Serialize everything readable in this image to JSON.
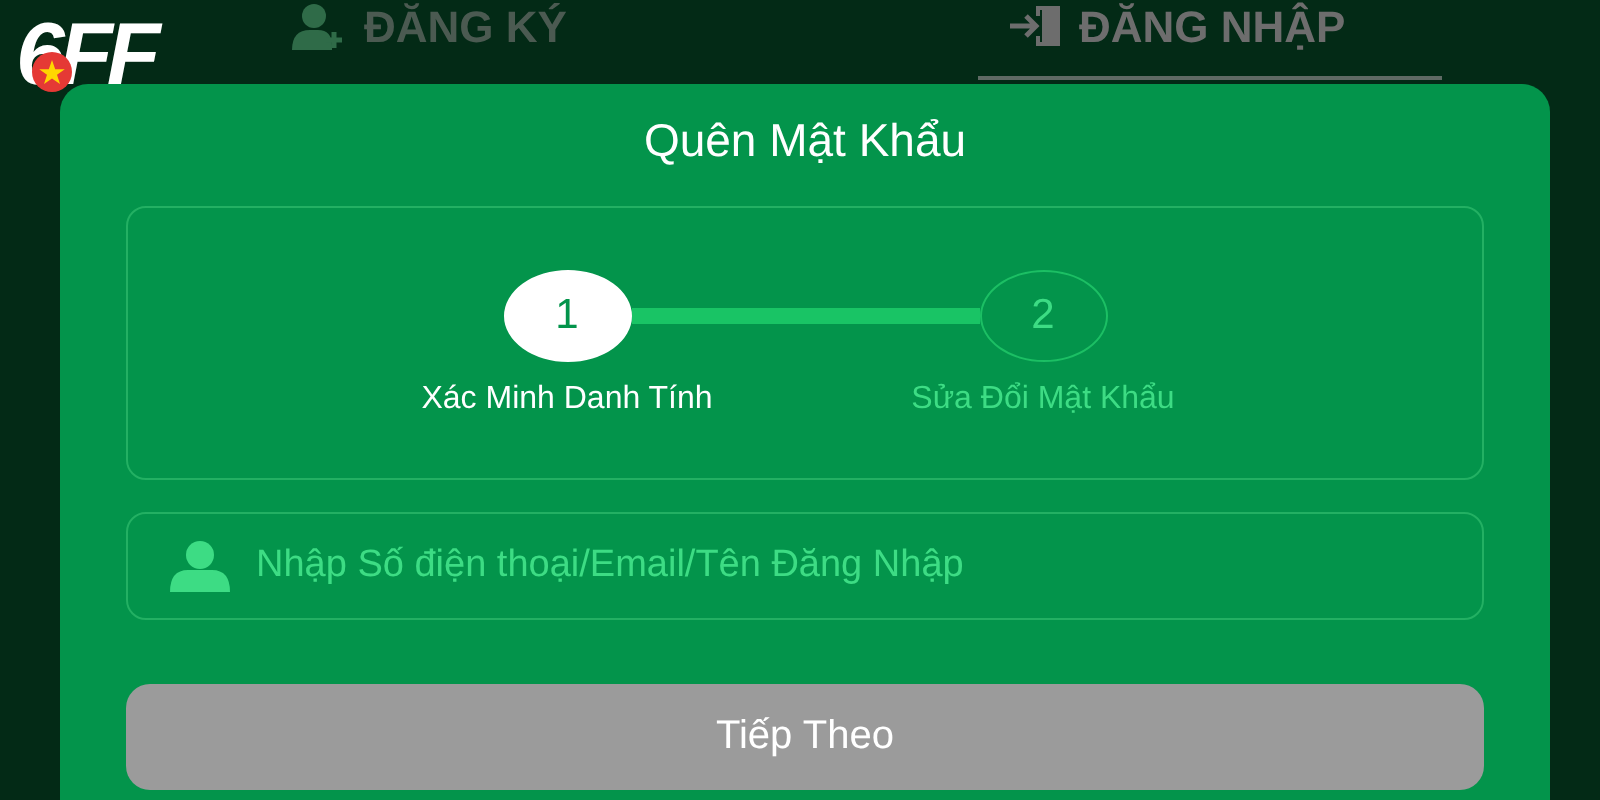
{
  "logo": {
    "text": "6FF"
  },
  "tabs": [
    {
      "label": "ĐĂNG KÝ",
      "kind": "register",
      "selected": false
    },
    {
      "label": "ĐĂNG NHẬP",
      "kind": "login",
      "selected": true
    }
  ],
  "dialog": {
    "title": "Quên Mật Khẩu",
    "steps": [
      {
        "number": "1",
        "label": "Xác Minh Danh Tính",
        "selected": true
      },
      {
        "number": "2",
        "label": "Sửa Đổi Mật Khẩu",
        "selected": false
      }
    ],
    "field": {
      "placeholder": "Nhập Số điện thoại/Email/Tên Đăng Nhập"
    },
    "button": {
      "label": "Tiếp Theo",
      "disabled": true
    }
  }
}
